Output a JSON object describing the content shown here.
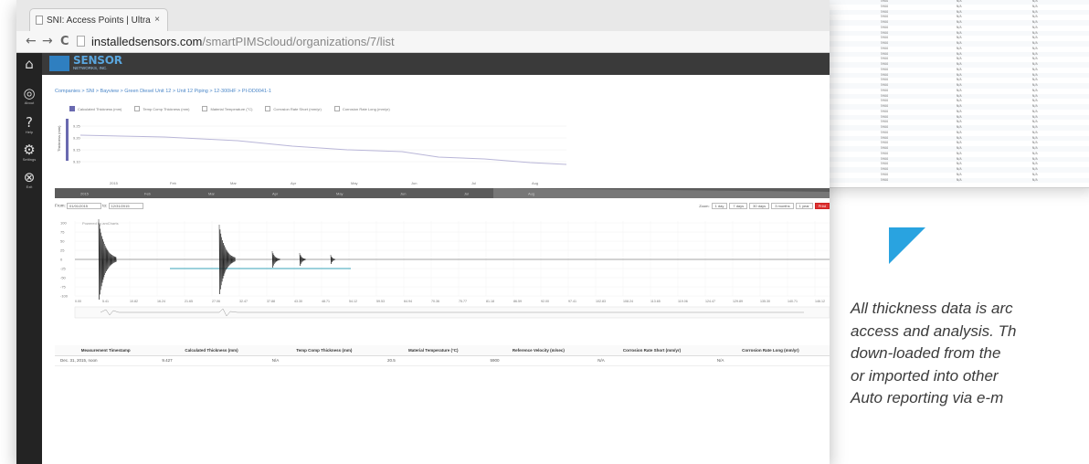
{
  "back_table": {
    "rows": [
      [
        "Dec. 18, 2015, noon",
        "9.432",
        "N/A",
        "20.5",
        "5900",
        "N/A",
        "N/A"
      ],
      [
        "Dec. 17, 2015, noon",
        "9.432",
        "N/A",
        "20.5",
        "5900",
        "N/A",
        "N/A"
      ],
      [
        "Dec. 16, 2015, noon",
        "9.432",
        "N/A",
        "20.5",
        "5900",
        "N/A",
        "N/A"
      ],
      [
        "Dec. 15, 2015, noon",
        "9.431",
        "N/A",
        "20.5",
        "5900",
        "N/A",
        "N/A"
      ],
      [
        "Dec. 14, 2015, noon",
        "9.431",
        "N/A",
        "20.5",
        "5900",
        "N/A",
        "N/A"
      ],
      [
        "Dec. 13, 2015, noon",
        "9.431",
        "N/A",
        "20.5",
        "5900",
        "N/A",
        "N/A"
      ],
      [
        "Dec. 12, 2015, noon",
        "9.431",
        "N/A",
        "20.5",
        "5900",
        "N/A",
        "N/A"
      ],
      [
        "Dec. 11, 2015, noon",
        "9.430",
        "N/A",
        "20.5",
        "5900",
        "N/A",
        "N/A"
      ],
      [
        "Dec. 10, 2015, noon",
        "9.430",
        "N/A",
        "20.5",
        "5900",
        "N/A",
        "N/A"
      ],
      [
        "Dec. 9, 2015, noon",
        "9.430",
        "N/A",
        "20.5",
        "5900",
        "N/A",
        "N/A"
      ],
      [
        "Dec. 8, 2015, noon",
        "9.430",
        "N/A",
        "20.5",
        "5900",
        "N/A",
        "N/A"
      ],
      [
        "Dec. 7, 2015, noon",
        "9.429",
        "N/A",
        "20.5",
        "5900",
        "N/A",
        "N/A"
      ],
      [
        "Dec. 6, 2015, noon",
        "9.429",
        "N/A",
        "20.5",
        "5900",
        "N/A",
        "N/A"
      ],
      [
        "Dec. 5, 2015, noon",
        "9.429",
        "N/A",
        "20.5",
        "5900",
        "N/A",
        "N/A"
      ],
      [
        "Dec. 4, 2015, noon",
        "9.429",
        "N/A",
        "20.5",
        "5900",
        "N/A",
        "N/A"
      ],
      [
        "Dec. 3, 2015, noon",
        "9.428",
        "N/A",
        "20.5",
        "5900",
        "N/A",
        "N/A"
      ],
      [
        "Dec. 2, 2015, noon",
        "9.428",
        "N/A",
        "20.5",
        "5900",
        "N/A",
        "N/A"
      ],
      [
        "Dec. 1, 2015, noon",
        "9.428",
        "N/A",
        "20.5",
        "5900",
        "N/A",
        "N/A"
      ],
      [
        "Nov. 30, 2015, noon",
        "9.428",
        "N/A",
        "20.5",
        "5900",
        "N/A",
        "N/A"
      ],
      [
        "Nov. 29, 2015, noon",
        "9.427",
        "N/A",
        "20.5",
        "5900",
        "N/A",
        "N/A"
      ],
      [
        "Nov. 28, 2015, noon",
        "9.427",
        "N/A",
        "20.5",
        "5900",
        "N/A",
        "N/A"
      ],
      [
        "Nov. 27, 2015, noon",
        "9.427",
        "N/A",
        "20.5",
        "5900",
        "N/A",
        "N/A"
      ],
      [
        "Nov. 26, 2015, noon",
        "9.427",
        "N/A",
        "20.5",
        "5900",
        "N/A",
        "N/A"
      ],
      [
        "Nov. 25, 2015, noon",
        "9.427",
        "N/A",
        "20.5",
        "5900",
        "N/A",
        "N/A"
      ],
      [
        "Nov. 24, 2015, noon",
        "9.426",
        "N/A",
        "20.5",
        "5900",
        "N/A",
        "N/A"
      ],
      [
        "Nov. 23, 2015, noon",
        "9.426",
        "N/A",
        "20.5",
        "5900",
        "N/A",
        "N/A"
      ],
      [
        "Nov. 22, 2015, noon",
        "9.426",
        "N/A",
        "20.5",
        "5900",
        "N/A",
        "N/A"
      ],
      [
        "Nov. 21, 2015, noon",
        "9.426",
        "N/A",
        "20.5",
        "5900",
        "N/A",
        "N/A"
      ],
      [
        "Nov. 20, 2015, noon",
        "9.425",
        "N/A",
        "20.5",
        "5900",
        "N/A",
        "N/A"
      ],
      [
        "Nov. 19, 2015, noon",
        "9.425",
        "N/A",
        "20.5",
        "5900",
        "N/A",
        "N/A"
      ],
      [
        "Nov. 18, 2015, noon",
        "9.425",
        "N/A",
        "20.5",
        "5900",
        "N/A",
        "N/A"
      ],
      [
        "Nov. 17, 2015, noon",
        "9.425",
        "N/A",
        "20.5",
        "5900",
        "N/A",
        "N/A"
      ],
      [
        "Nov. 16, 2015, noon",
        "9.424",
        "N/A",
        "20.5",
        "5900",
        "N/A",
        "N/A"
      ],
      [
        "Nov. 15, 2015, noon",
        "9.424",
        "N/A",
        "20.5",
        "5900",
        "N/A",
        "N/A"
      ],
      [
        "Nov. 14, 2015, noon",
        "9.424",
        "N/A",
        "20.5",
        "5900",
        "N/A",
        "N/A"
      ]
    ]
  },
  "browser": {
    "tab_title": "SNI: Access Points | Ultra",
    "tab_close": "×",
    "back": "←",
    "forward": "→",
    "reload": "C",
    "url_host": "installedsensors.com",
    "url_path": "/smartPIMScloud/organizations/7/list"
  },
  "sidebar": {
    "items": [
      {
        "glyph": "⌂",
        "label": "",
        "icon": "home-icon"
      },
      {
        "glyph": "◎",
        "label": "About",
        "icon": "about-icon"
      },
      {
        "glyph": "?",
        "label": "Help",
        "icon": "help-icon"
      },
      {
        "glyph": "⚙",
        "label": "Settings",
        "icon": "settings-icon"
      },
      {
        "glyph": "⊗",
        "label": "Exit",
        "icon": "exit-icon"
      }
    ]
  },
  "logo": {
    "text": "SENSOR",
    "sub": "NETWORKS, INC."
  },
  "breadcrumb": "Companies > SNI > Bayview > Green Diesel Unit 12 > Unit 12 Piping > 12-300HF > PI-DD0041-1",
  "legend": [
    "Calculated Thickness (mm)",
    "Temp Comp Thickness (mm)",
    "Material Temperature (°C)",
    "Corrosion Rate Short (mm/yr)",
    "Corrosion Rate Long (mm/yr)"
  ],
  "chart1": {
    "ylabel": "Thickness (mm)",
    "ticks_y": [
      "9.25",
      "9.20",
      "9.15",
      "9.10"
    ],
    "ticks_x": [
      "2015",
      "Feb",
      "Mar",
      "Apr",
      "May",
      "Jun",
      "Jul",
      "Aug"
    ]
  },
  "navigator_labels": [
    "2015",
    "Feb",
    "Mar",
    "Apr",
    "May",
    "Jun",
    "Jul",
    "Aug"
  ],
  "range": {
    "from_label": "From:",
    "from_value": "01/01/2015",
    "to_label": "to:",
    "to_value": "12/31/2015",
    "zoom_label": "Zoom:",
    "zoom_buttons": [
      "1 day",
      "7 days",
      "30 days",
      "3 months",
      "1 year"
    ],
    "print_label": "Print"
  },
  "chart2": {
    "credit": "Powered by amCharts",
    "ticks_y": [
      "100",
      "75",
      "50",
      "25",
      "0",
      "-25",
      "-50",
      "-75",
      "-100"
    ],
    "ticks_x": [
      "0.00",
      "5.41",
      "10.82",
      "16.24",
      "21.65",
      "27.06",
      "32.47",
      "37.88",
      "43.30",
      "48.71",
      "54.12",
      "59.53",
      "64.94",
      "70.36",
      "75.77",
      "81.18",
      "86.59",
      "92.00",
      "97.41",
      "102.83",
      "108.24",
      "113.65",
      "119.06",
      "124.47",
      "129.89",
      "135.30",
      "140.71",
      "146.12"
    ]
  },
  "data_table": {
    "headers": [
      "Measurement Timestamp",
      "Calculated Thickness (mm)",
      "Temp Comp Thickness (mm)",
      "Material Temperature (°C)",
      "Reference Velocity (m/sec)",
      "Corrosion Rate Short (mm/yr)",
      "Corrosion Rate Long (mm/yr)"
    ],
    "rows": [
      [
        "Dec. 31, 2015, noon",
        "9.427",
        "N/A",
        "20.5",
        "5900",
        "N/A",
        "N/A"
      ]
    ]
  },
  "marketing": {
    "lines": [
      "All thickness data is arc",
      "access and analysis. Th",
      "down-loaded from the",
      "or imported into other",
      "Auto reporting via e-m"
    ],
    "accent_color": "#29a3e0"
  }
}
